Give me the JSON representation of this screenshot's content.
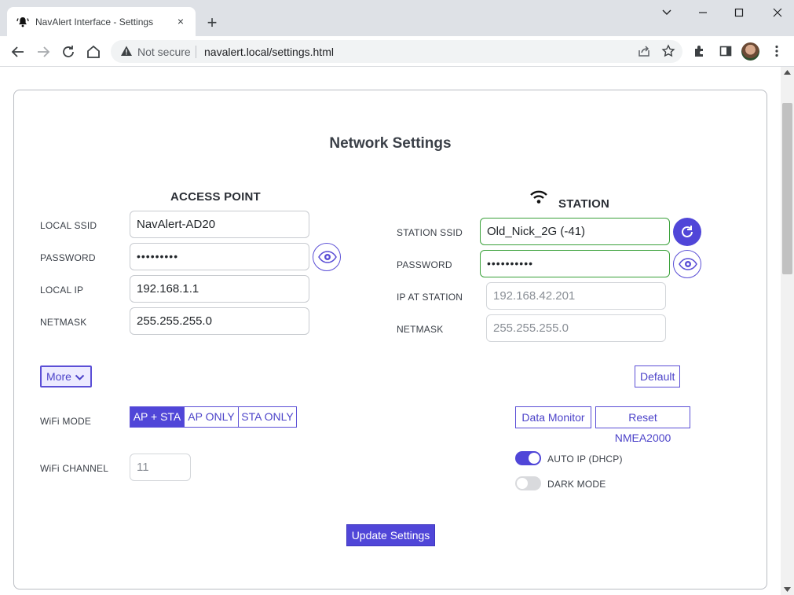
{
  "browser": {
    "tab_title": "NavAlert Interface - Settings",
    "tab_close": "×",
    "new_tab": "+",
    "not_secure": "Not secure",
    "url": "navalert.local/settings.html"
  },
  "page": {
    "top_fragment": "\"",
    "title": "Network Settings",
    "access_point": {
      "heading": "ACCESS POINT",
      "ssid_label": "LOCAL SSID",
      "ssid_value": "NavAlert-AD20",
      "password_label": "PASSWORD",
      "password_value": "•••••••••",
      "ip_label": "LOCAL IP",
      "ip_value": "192.168.1.1",
      "netmask_label": "NETMASK",
      "netmask_value": "255.255.255.0"
    },
    "station": {
      "heading": "STATION",
      "ssid_label": "STATION SSID",
      "ssid_value": "Old_Nick_2G (-41)",
      "password_label": "PASSWORD",
      "password_value": "••••••••••",
      "ip_label": "IP AT STATION",
      "ip_value": "192.168.42.201",
      "netmask_label": "NETMASK",
      "netmask_value": "255.255.255.0"
    },
    "more_button": "More",
    "default_button": "Default",
    "wifi_mode_label": "WiFi MODE",
    "wifi_modes": [
      "AP + STA",
      "AP ONLY",
      "STA ONLY"
    ],
    "wifi_mode_selected": "AP + STA",
    "wifi_channel_label": "WiFi CHANNEL",
    "wifi_channel_value": "11",
    "data_monitor_button": "Data Monitor",
    "reset_nmea_button": "Reset NMEA2000",
    "auto_ip_label": "AUTO IP (DHCP)",
    "auto_ip_on": true,
    "dark_mode_label": "DARK MODE",
    "dark_mode_on": false,
    "update_button": "Update Settings"
  },
  "colors": {
    "accent": "#5046d8",
    "field_valid": "#3aa13a",
    "chrome_tabbar": "#dee1e6"
  }
}
